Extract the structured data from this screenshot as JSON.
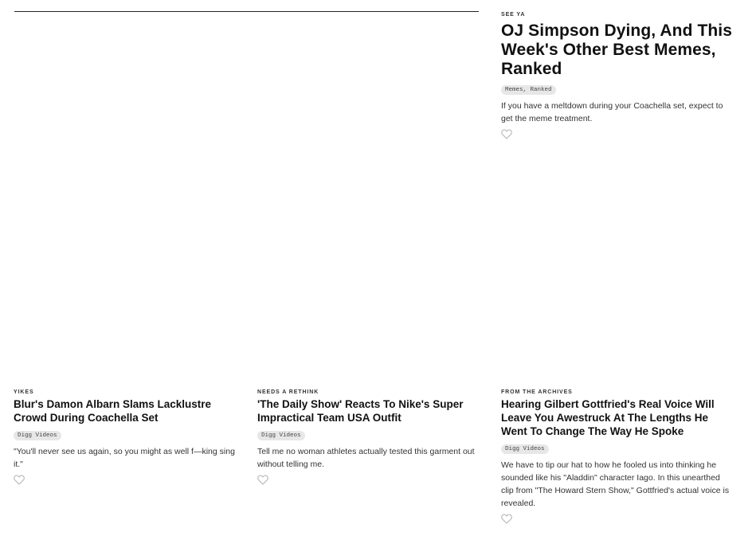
{
  "featured": {
    "kicker": "SEE YA",
    "title": "OJ Simpson Dying, And This Week's Other Best Memes, Ranked",
    "tag": "Memes, Ranked",
    "description": "If you have a meltdown during your Coachella set, expect to get the meme treatment.",
    "like_icon": "heart-outline-icon"
  },
  "cards": [
    {
      "kicker": "YIKES",
      "title": "Blur's Damon Albarn Slams Lacklustre Crowd During Coachella Set",
      "tag": "Digg Videos",
      "description": "\"You'll never see us again, so you might as well f—king sing it.\"",
      "like_icon": "heart-outline-icon"
    },
    {
      "kicker": "NEEDS A RETHINK",
      "title": "'The Daily Show' Reacts To Nike's Super Impractical Team USA Outfit",
      "tag": "Digg Videos",
      "description": "Tell me no woman athletes actually tested this garment out without telling me.",
      "like_icon": "heart-outline-icon"
    },
    {
      "kicker": "FROM THE ARCHIVES",
      "title": "Hearing Gilbert Gottfried's Real Voice Will Leave You Awestruck At The Lengths He Went To Change The Way He Spoke",
      "tag": "Digg Videos",
      "description": "We have to tip our hat to how he fooled us into thinking he sounded like his \"Aladdin\" character Iago. In this unearthed clip from \"The Howard Stern Show,\" Gottfried's actual voice is revealed.",
      "like_icon": "heart-outline-icon"
    }
  ]
}
